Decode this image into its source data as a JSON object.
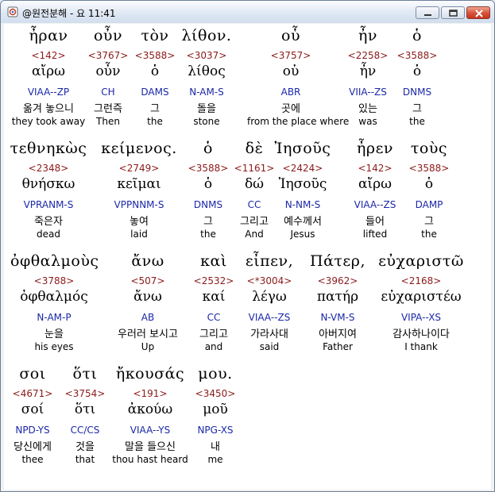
{
  "window": {
    "title": "@원전분해 - 요 11:41"
  },
  "rows": [
    {
      "words": [
        {
          "greek": "ἦραν",
          "strong": "<142>",
          "lemma": "αἴρω",
          "morph": "VIAA--ZP",
          "kor": "옮겨 놓으니",
          "eng": "they took away"
        },
        {
          "greek": "οὖν",
          "strong": "<3767>",
          "lemma": "οὖν",
          "morph": "CH",
          "kor": "그런즉",
          "eng": "Then"
        },
        {
          "greek": "τὸν",
          "strong": "<3588>",
          "lemma": "ὁ",
          "morph": "DAMS",
          "kor": "그",
          "eng": "the"
        },
        {
          "greek": "λίθον.",
          "strong": "<3037>",
          "lemma": "λίθος",
          "morph": "N-AM-S",
          "kor": "돌을",
          "eng": "stone"
        },
        {
          "greek": "οὗ",
          "strong": "<3757>",
          "lemma": "οὑ",
          "morph": "ABR",
          "kor": "곳에",
          "eng": "from the place where"
        },
        {
          "greek": "ἦν",
          "strong": "<2258>",
          "lemma": "ἦν",
          "morph": "VIIA--ZS",
          "kor": "있는",
          "eng": "was"
        },
        {
          "greek": "ὁ",
          "strong": "<3588>",
          "lemma": "ὁ",
          "morph": "DNMS",
          "kor": "그",
          "eng": "the"
        }
      ]
    },
    {
      "words": [
        {
          "greek": "τεθνηκὼς",
          "strong": "<2348>",
          "lemma": "θνήσκω",
          "morph": "VPRANM-S",
          "kor": "죽은자",
          "eng": "dead"
        },
        {
          "greek": "κείμενος.",
          "strong": "<2749>",
          "lemma": "κεῖμαι",
          "morph": "VPPNNM-S",
          "kor": "놓여",
          "eng": "laid"
        },
        {
          "greek": "ὁ",
          "strong": "<3588>",
          "lemma": "ὁ",
          "morph": "DNMS",
          "kor": "그",
          "eng": "the"
        },
        {
          "greek": "δὲ",
          "strong": "<1161>",
          "lemma": "δώ",
          "morph": "CC",
          "kor": "그리고",
          "eng": "And"
        },
        {
          "greek": "Ἰησοῦς",
          "strong": "<2424>",
          "lemma": "Ἰησοῦς",
          "morph": "N-NM-S",
          "kor": "예수께서",
          "eng": "Jesus"
        },
        {
          "greek": "ἦρεν",
          "strong": "<142>",
          "lemma": "αἴρω",
          "morph": "VIAA--ZS",
          "kor": "들어",
          "eng": "lifted"
        },
        {
          "greek": "τοὺς",
          "strong": "<3588>",
          "lemma": "ὁ",
          "morph": "DAMP",
          "kor": "그",
          "eng": "the"
        }
      ]
    },
    {
      "words": [
        {
          "greek": "ὀφθαλμοὺς",
          "strong": "<3788>",
          "lemma": "ὀφθαλμός",
          "morph": "N-AM-P",
          "kor": "눈을",
          "eng": "his eyes"
        },
        {
          "greek": "ἄνω",
          "strong": "<507>",
          "lemma": "ἄνω",
          "morph": "AB",
          "kor": "우러러 보시고",
          "eng": "Up"
        },
        {
          "greek": "καὶ",
          "strong": "<2532>",
          "lemma": "καί",
          "morph": "CC",
          "kor": "그리고",
          "eng": "and"
        },
        {
          "greek": "εἶπεν,",
          "strong": "<*3004>",
          "lemma": "λέγω",
          "morph": "VIAA--ZS",
          "kor": "가라사대",
          "eng": "said"
        },
        {
          "greek": "Πάτερ,",
          "strong": "<3962>",
          "lemma": "πατήρ",
          "morph": "N-VM-S",
          "kor": "아버지여",
          "eng": "Father"
        },
        {
          "greek": "εὐχαριστῶ",
          "strong": "<2168>",
          "lemma": "εὐχαριστέω",
          "morph": "VIPA--XS",
          "kor": "감사하나이다",
          "eng": "I thank"
        }
      ]
    },
    {
      "words": [
        {
          "greek": "σοι",
          "strong": "<4671>",
          "lemma": "σοί",
          "morph": "NPD-YS",
          "kor": "당신에게",
          "eng": "thee"
        },
        {
          "greek": "ὅτι",
          "strong": "<3754>",
          "lemma": "ὅτι",
          "morph": "CC/CS",
          "kor": "것을",
          "eng": "that"
        },
        {
          "greek": "ἤκουσάς",
          "strong": "<191>",
          "lemma": "ἀκούω",
          "morph": "VIAA--YS",
          "kor": "말을 들으신",
          "eng": "thou hast heard"
        },
        {
          "greek": "μου.",
          "strong": "<3450>",
          "lemma": "μοῦ",
          "morph": "NPG-XS",
          "kor": "내",
          "eng": "me"
        }
      ]
    }
  ]
}
